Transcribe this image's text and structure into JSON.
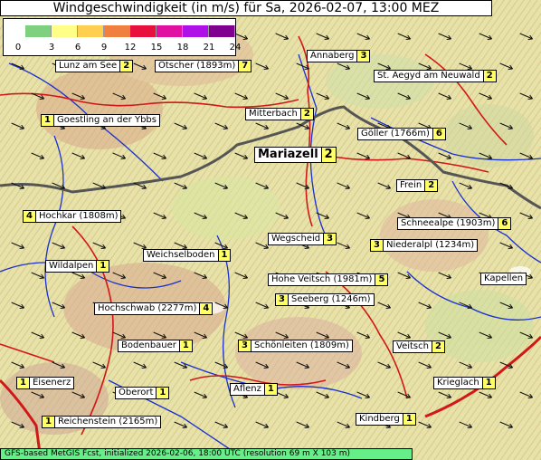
{
  "title": "Windgeschwindigkeit (in m/s) für Sa, 2026-02-07, 13:00 MEZ",
  "footer": "GFS-based MetGIS Fcst, initialized 2026-02-06, 18:00 UTC  (resolution 69 m X 103 m)",
  "legend": {
    "ticks": [
      "0",
      "3",
      "6",
      "9",
      "12",
      "15",
      "18",
      "21",
      "24"
    ],
    "colors": [
      "#7fd07f",
      "#ffff88",
      "#ffd050",
      "#f08040",
      "#e8103c",
      "#e010a0",
      "#b010e8",
      "#800090"
    ]
  },
  "colors": {
    "road": "#d01818",
    "border": "#555555",
    "river": "#1a30d0",
    "snow": "#ffffff"
  },
  "places": [
    {
      "name": "Lunz am See",
      "value": "2",
      "side": "right"
    },
    {
      "name": "Ötscher (1893m)",
      "value": "7",
      "side": "right"
    },
    {
      "name": "Annaberg",
      "value": "3",
      "side": "right"
    },
    {
      "name": "St. Aegyd am Neuwald",
      "value": "2",
      "side": "right"
    },
    {
      "name": "Goestling an der Ybbs",
      "value": "1",
      "side": "left"
    },
    {
      "name": "Mitterbach",
      "value": "2",
      "side": "right"
    },
    {
      "name": "Göller (1766m)",
      "value": "6",
      "side": "right"
    },
    {
      "name": "Mariazell",
      "value": "2",
      "side": "right",
      "big": true
    },
    {
      "name": "Frein",
      "value": "2",
      "side": "right"
    },
    {
      "name": "Hochkar (1808m)",
      "value": "4",
      "side": "left"
    },
    {
      "name": "Schneealpe (1903m)",
      "value": "6",
      "side": "right"
    },
    {
      "name": "Wegscheid",
      "value": "3",
      "side": "right"
    },
    {
      "name": "Niederalpl (1234m)",
      "value": "3",
      "side": "left"
    },
    {
      "name": "Weichselboden",
      "value": "1",
      "side": "right"
    },
    {
      "name": "Wildalpen",
      "value": "1",
      "side": "right"
    },
    {
      "name": "Hohe Veitsch (1981m)",
      "value": "5",
      "side": "right"
    },
    {
      "name": "Kapellen",
      "value": "",
      "side": "right"
    },
    {
      "name": "Seeberg (1246m)",
      "value": "3",
      "side": "left"
    },
    {
      "name": "Hochschwab (2277m)",
      "value": "4",
      "side": "right"
    },
    {
      "name": "Bodenbauer",
      "value": "1",
      "side": "right"
    },
    {
      "name": "Schönleiten (1809m)",
      "value": "3",
      "side": "left"
    },
    {
      "name": "Veitsch",
      "value": "2",
      "side": "right"
    },
    {
      "name": "Eisenerz",
      "value": "1",
      "side": "left"
    },
    {
      "name": "Krieglach",
      "value": "1",
      "side": "right"
    },
    {
      "name": "Oberort",
      "value": "1",
      "side": "right"
    },
    {
      "name": "Aflenz",
      "value": "1",
      "side": "right"
    },
    {
      "name": "Reichenstein (2165m)",
      "value": "1",
      "side": "left"
    },
    {
      "name": "Kindberg",
      "value": "1",
      "side": "right"
    }
  ]
}
